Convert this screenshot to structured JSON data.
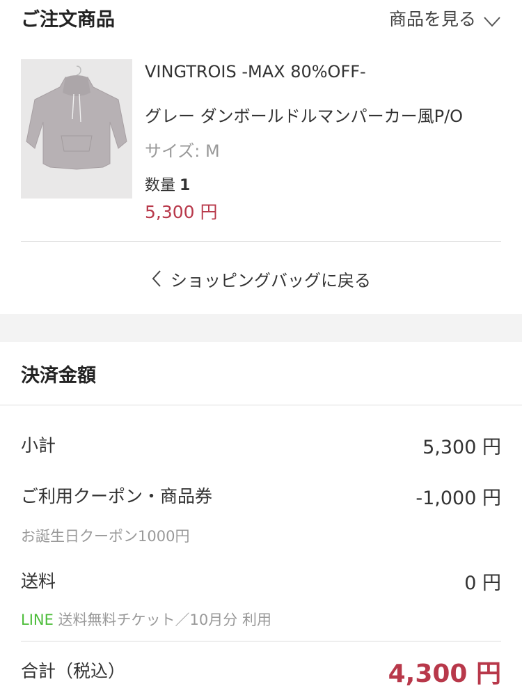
{
  "order": {
    "title": "ご注文商品",
    "view_items_label": "商品を見る",
    "product": {
      "brand": "VINGTROIS -MAX 80%OFF-",
      "name": "グレー ダンボールドルマンパーカー風P/O",
      "size": "サイズ: M",
      "qty_label": "数量",
      "qty_value": "1",
      "price": "5,300 円"
    },
    "back_label": "ショッピングバッグに戻る"
  },
  "payment": {
    "title": "決済金額",
    "subtotal": {
      "label": "小計",
      "value": "5,300 円"
    },
    "coupon": {
      "label": "ご利用クーポン・商品券",
      "value": "-1,000 円",
      "note": "お誕生日クーポン1000円"
    },
    "shipping": {
      "label": "送料",
      "value": "0 円",
      "note_prefix": "LINE",
      "note_rest": " 送料無料チケット／10月分 利用"
    },
    "total": {
      "label": "合計（税込）",
      "value": "4,300 円"
    }
  },
  "colors": {
    "price_red": "#b8384a",
    "line_green": "#4cbd3a",
    "band_gray": "#f3f3f3"
  },
  "icons": {
    "view_items": "chevron-down-icon",
    "back": "chevron-left-icon"
  }
}
